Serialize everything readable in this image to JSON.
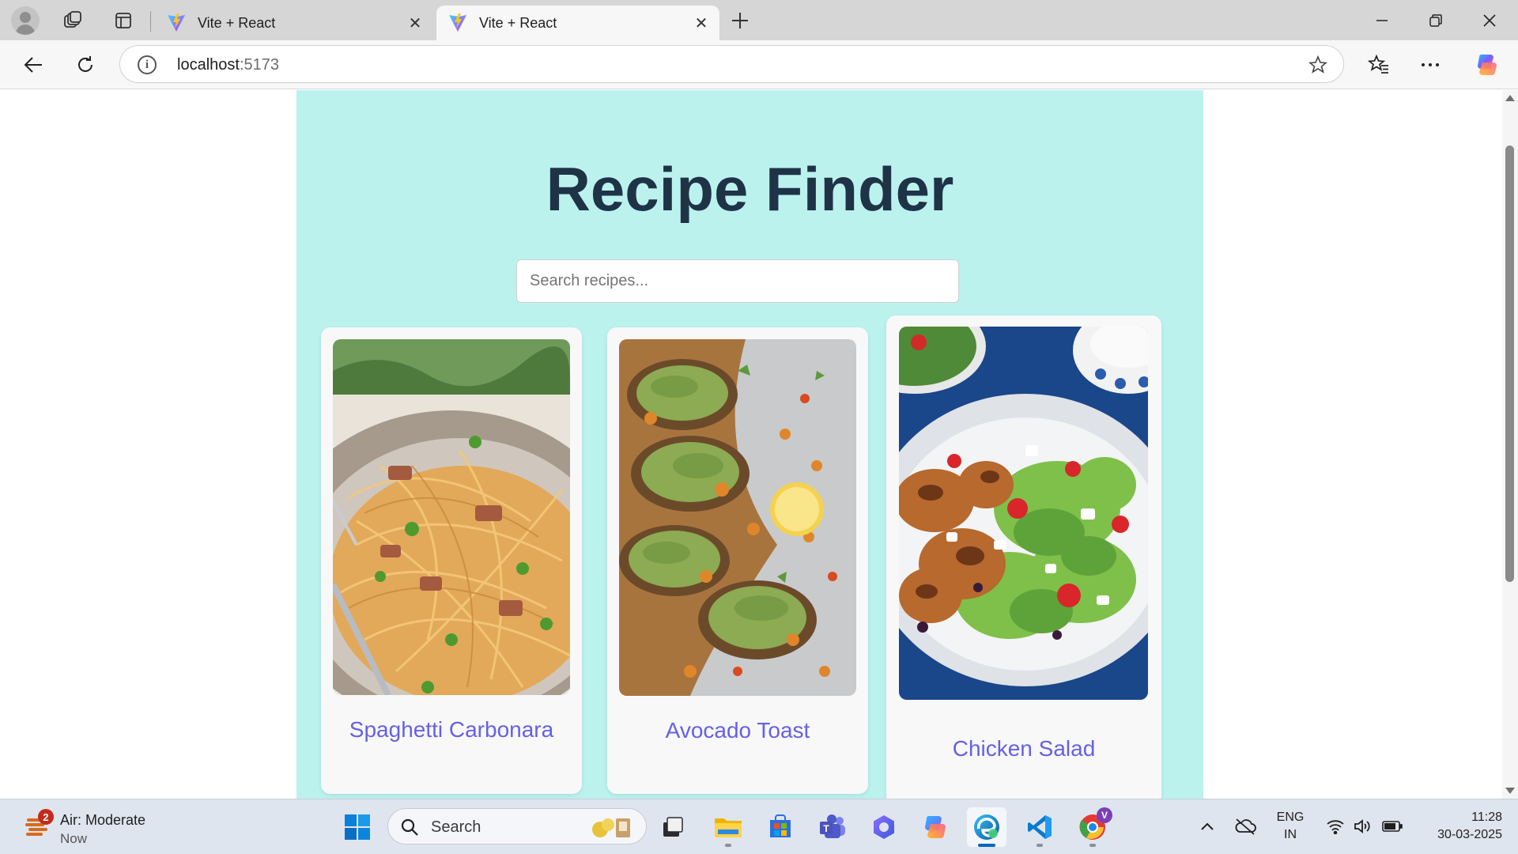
{
  "browser": {
    "tabs": [
      {
        "title": "Vite + React",
        "active": false
      },
      {
        "title": "Vite + React",
        "active": true
      }
    ],
    "address": {
      "host": "localhost",
      "port": ":5173"
    }
  },
  "app": {
    "title": "Recipe Finder",
    "search": {
      "placeholder": "Search recipes...",
      "value": ""
    },
    "recipes": [
      {
        "name": "Spaghetti Carbonara",
        "image": "spaghetti-carbonara-photo"
      },
      {
        "name": "Avocado Toast",
        "image": "avocado-toast-photo"
      },
      {
        "name": "Chicken Salad",
        "image": "chicken-salad-photo"
      }
    ],
    "colors": {
      "background": "#bbf2ee",
      "title": "#1f3347",
      "recipe_name": "#6560e6",
      "card": "#f8f8f8"
    }
  },
  "taskbar": {
    "weather": {
      "label": "Air: Moderate",
      "sub": "Now",
      "badge": "2"
    },
    "search_label": "Search",
    "language": {
      "line1": "ENG",
      "line2": "IN"
    },
    "clock": {
      "time": "11:28",
      "date": "30-03-2025"
    },
    "chrome_profile_badge": "V"
  }
}
